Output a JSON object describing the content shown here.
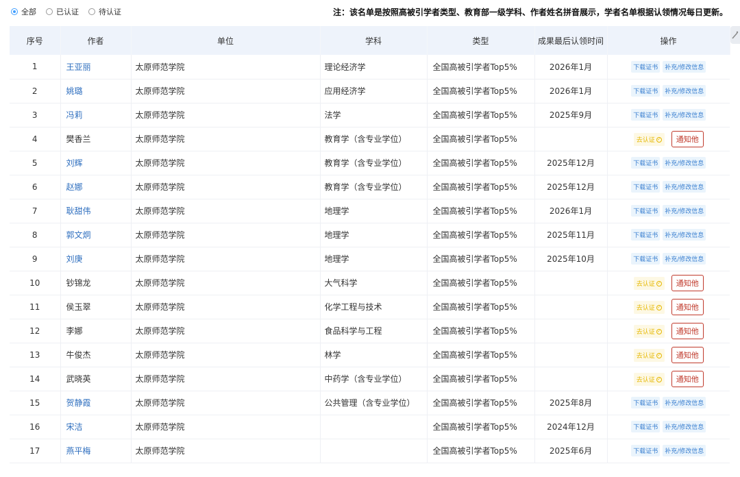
{
  "filters": [
    {
      "label": "全部",
      "checked": true
    },
    {
      "label": "已认证",
      "checked": false
    },
    {
      "label": "待认证",
      "checked": false
    }
  ],
  "notice": "注：该名单是按照高被引学者类型、教育部一级学科、作者姓名拼音展示，学者名单根据认领情况每日更新。",
  "columns": [
    "序号",
    "作者",
    "单位",
    "学科",
    "类型",
    "成果最后认领时间",
    "操作"
  ],
  "actions": {
    "download": "下载证书",
    "edit": "补充/修改信息",
    "pending": "去认证",
    "notify": "通知他"
  },
  "rows": [
    {
      "idx": "1",
      "name": "王亚丽",
      "unit": "太原师范学院",
      "subject": "理论经济学",
      "type": "全国高被引学者Top5%",
      "time": "2026年1月",
      "certified": true
    },
    {
      "idx": "2",
      "name": "姚璐",
      "unit": "太原师范学院",
      "subject": "应用经济学",
      "type": "全国高被引学者Top5%",
      "time": "2026年1月",
      "certified": true
    },
    {
      "idx": "3",
      "name": "冯莉",
      "unit": "太原师范学院",
      "subject": "法学",
      "type": "全国高被引学者Top5%",
      "time": "2025年9月",
      "certified": true
    },
    {
      "idx": "4",
      "name": "樊香兰",
      "unit": "太原师范学院",
      "subject": "教育学（含专业学位）",
      "type": "全国高被引学者Top5%",
      "time": "",
      "certified": false
    },
    {
      "idx": "5",
      "name": "刘辉",
      "unit": "太原师范学院",
      "subject": "教育学（含专业学位）",
      "type": "全国高被引学者Top5%",
      "time": "2025年12月",
      "certified": true
    },
    {
      "idx": "6",
      "name": "赵娜",
      "unit": "太原师范学院",
      "subject": "教育学（含专业学位）",
      "type": "全国高被引学者Top5%",
      "time": "2025年12月",
      "certified": true
    },
    {
      "idx": "7",
      "name": "耿甜伟",
      "unit": "太原师范学院",
      "subject": "地理学",
      "type": "全国高被引学者Top5%",
      "time": "2026年1月",
      "certified": true
    },
    {
      "idx": "8",
      "name": "郭文炯",
      "unit": "太原师范学院",
      "subject": "地理学",
      "type": "全国高被引学者Top5%",
      "time": "2025年11月",
      "certified": true
    },
    {
      "idx": "9",
      "name": "刘庚",
      "unit": "太原师范学院",
      "subject": "地理学",
      "type": "全国高被引学者Top5%",
      "time": "2025年10月",
      "certified": true
    },
    {
      "idx": "10",
      "name": "钞锦龙",
      "unit": "太原师范学院",
      "subject": "大气科学",
      "type": "全国高被引学者Top5%",
      "time": "",
      "certified": false
    },
    {
      "idx": "11",
      "name": "侯玉翠",
      "unit": "太原师范学院",
      "subject": "化学工程与技术",
      "type": "全国高被引学者Top5%",
      "time": "",
      "certified": false
    },
    {
      "idx": "12",
      "name": "李娜",
      "unit": "太原师范学院",
      "subject": "食品科学与工程",
      "type": "全国高被引学者Top5%",
      "time": "",
      "certified": false
    },
    {
      "idx": "13",
      "name": "牛俊杰",
      "unit": "太原师范学院",
      "subject": "林学",
      "type": "全国高被引学者Top5%",
      "time": "",
      "certified": false
    },
    {
      "idx": "14",
      "name": "武晓英",
      "unit": "太原师范学院",
      "subject": "中药学（含专业学位）",
      "type": "全国高被引学者Top5%",
      "time": "",
      "certified": false
    },
    {
      "idx": "15",
      "name": "贺静霞",
      "unit": "太原师范学院",
      "subject": "公共管理（含专业学位）",
      "type": "全国高被引学者Top5%",
      "time": "2025年8月",
      "certified": true
    },
    {
      "idx": "16",
      "name": "宋洁",
      "unit": "太原师范学院",
      "subject": "",
      "type": "全国高被引学者Top5%",
      "time": "2024年12月",
      "certified": true
    },
    {
      "idx": "17",
      "name": "燕平梅",
      "unit": "太原师范学院",
      "subject": "",
      "type": "全国高被引学者Top5%",
      "time": "2025年6月",
      "certified": true
    }
  ]
}
